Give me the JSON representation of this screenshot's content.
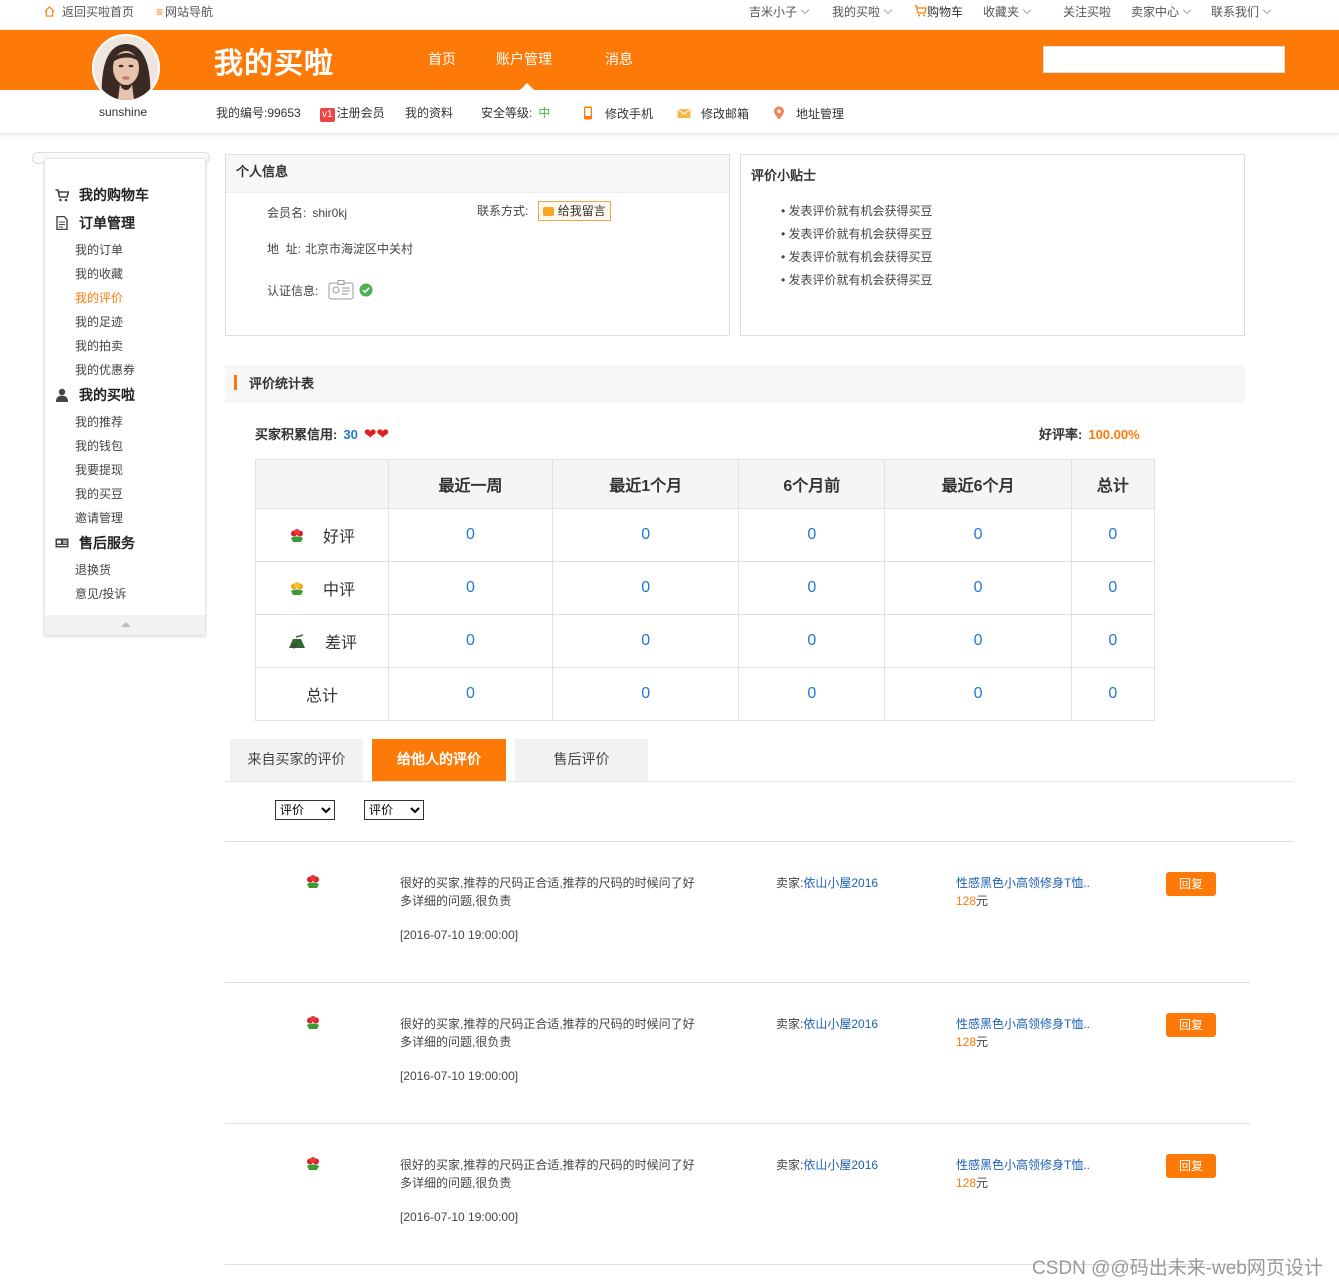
{
  "topbar": {
    "home": "返回买啦首页",
    "sitenav": "网站导航",
    "user": "吉米小子",
    "mybuy": "我的买啦",
    "cart": "购物车",
    "favorites": "收藏夹",
    "follow": "关注买啦",
    "seller": "卖家中心",
    "contact": "联系我们"
  },
  "header": {
    "brand": "我的买啦",
    "nav": [
      "首页",
      "账户管理",
      "消息"
    ],
    "search_placeholder": "",
    "accent": "#fe7a08"
  },
  "user": {
    "name": "sunshine",
    "id": "我的编号:99653",
    "vip_badge": "v1",
    "vip": "注册会员",
    "profile": "我的资料",
    "security_label": "安全等级:",
    "security_level": "中",
    "phone": "修改手机",
    "email": "修改邮箱",
    "address": "地址管理"
  },
  "sidebar": {
    "cart": "我的购物车",
    "orders": "订单管理",
    "order_items": [
      "我的订单",
      "我的收藏",
      "我的评价",
      "我的足迹",
      "我的拍卖",
      "我的优惠券"
    ],
    "mymaila": "我的买啦",
    "mymaila_items": [
      "我的推荐",
      "我的钱包",
      "我要提现",
      "我的买豆",
      "邀请管理"
    ],
    "service": "售后服务",
    "service_items": [
      "退换货",
      "意见/投诉"
    ]
  },
  "personal": {
    "title": "个人信息",
    "member_label": "会员名:",
    "member": "shir0kj",
    "contact_label": "联系方式:",
    "message_btn": "给我留言",
    "address_label": "地  址:",
    "address": "北京市海淀区中关村",
    "cert_label": "认证信息:"
  },
  "tips": {
    "title": "评价小贴士",
    "items": [
      "发表评价就有机会获得买豆",
      "发表评价就有机会获得买豆",
      "发表评价就有机会获得买豆",
      "发表评价就有机会获得买豆"
    ]
  },
  "stats": {
    "title": "评价统计表",
    "credit_label": "买家积累信用:",
    "credit": "30",
    "rate_label": "好评率:",
    "rate": "100.00%",
    "columns": [
      "",
      "最近一周",
      "最近1个月",
      "6个月前",
      "最近6个月",
      "总计"
    ],
    "rows": [
      {
        "label": "好评",
        "icon": "red-flower-icon",
        "values": [
          "0",
          "0",
          "0",
          "0",
          "0"
        ]
      },
      {
        "label": "中评",
        "icon": "yellow-flower-icon",
        "values": [
          "0",
          "0",
          "0",
          "0",
          "0"
        ]
      },
      {
        "label": "差评",
        "icon": "trash-icon",
        "values": [
          "0",
          "0",
          "0",
          "0",
          "0"
        ]
      },
      {
        "label": "总计",
        "icon": "",
        "values": [
          "0",
          "0",
          "0",
          "0",
          "0"
        ]
      }
    ]
  },
  "tabs": [
    "来自买家的评价",
    "给他人的评价",
    "售后评价"
  ],
  "filters": [
    "评价",
    "评价"
  ],
  "reviews": [
    {
      "text": "很好的买家,推荐的尺码正合适,推荐的尺码的时候问了好多详细的问题,很负责",
      "date": "[2016-07-10 19:00:00]",
      "seller_label": "卖家:",
      "seller": "依山小屋2016",
      "product": "性感黑色小高领修身T恤..",
      "price": "128",
      "unit": "元",
      "reply": "回复"
    },
    {
      "text": "很好的买家,推荐的尺码正合适,推荐的尺码的时候问了好多详细的问题,很负责",
      "date": "[2016-07-10 19:00:00]",
      "seller_label": "卖家:",
      "seller": "依山小屋2016",
      "product": "性感黑色小高领修身T恤..",
      "price": "128",
      "unit": "元",
      "reply": "回复"
    },
    {
      "text": "很好的买家,推荐的尺码正合适,推荐的尺码的时候问了好多详细的问题,很负责",
      "date": "[2016-07-10 19:00:00]",
      "seller_label": "卖家:",
      "seller": "依山小屋2016",
      "product": "性感黑色小高领修身T恤..",
      "price": "128",
      "unit": "元",
      "reply": "回复"
    }
  ],
  "watermark": "CSDN @@码出未来-web网页设计"
}
